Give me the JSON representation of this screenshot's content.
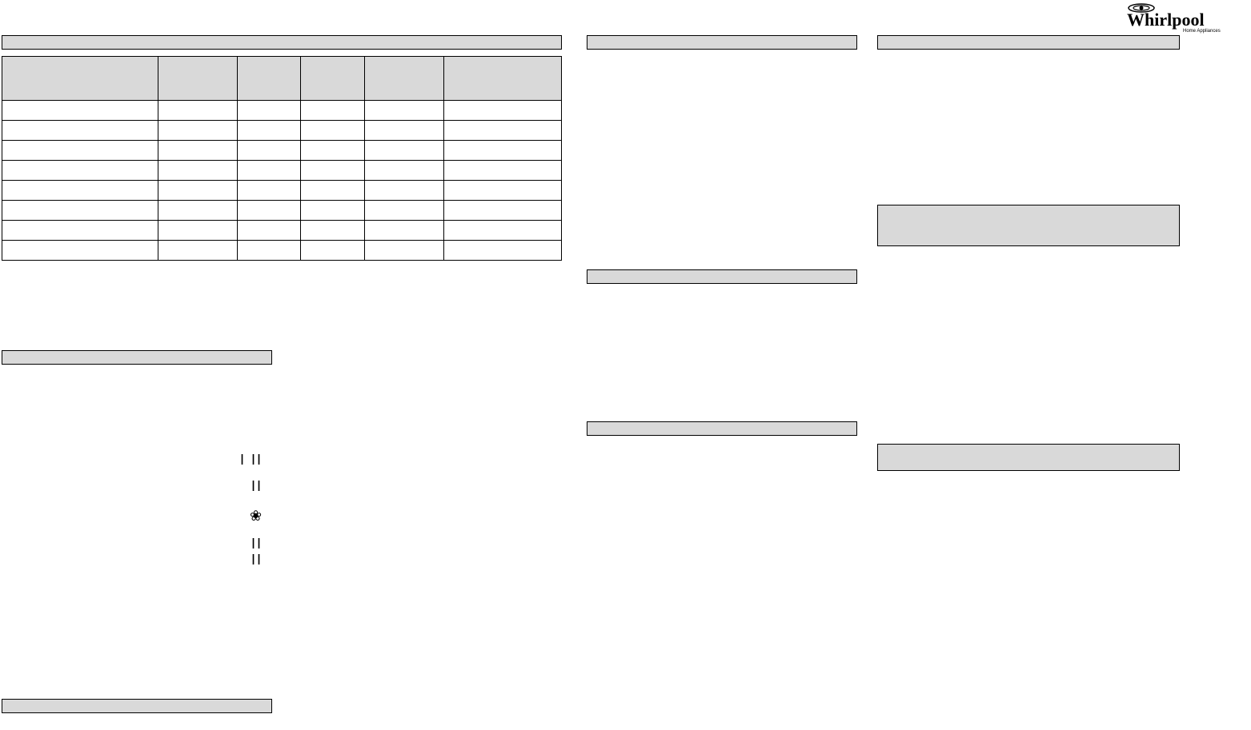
{
  "logo_text": "Whirlpool",
  "logo_sub": "Home Appliances",
  "table": {
    "headers": [
      "",
      "",
      "",
      "",
      "",
      ""
    ],
    "rows": [
      [
        "",
        "",
        "",
        "",
        "",
        ""
      ],
      [
        "",
        "",
        "",
        "",
        "",
        ""
      ],
      [
        "",
        "",
        "",
        "",
        "",
        ""
      ],
      [
        "",
        "",
        "",
        "",
        "",
        ""
      ],
      [
        "",
        "",
        "",
        "",
        "",
        ""
      ],
      [
        "",
        "",
        "",
        "",
        "",
        ""
      ],
      [
        "",
        "",
        "",
        "",
        "",
        ""
      ],
      [
        "",
        "",
        "",
        "",
        "",
        ""
      ]
    ]
  },
  "glyphs": {
    "g1": "I  II",
    "g2": "II",
    "g3": "❀",
    "g4": "II",
    "g5": "II"
  }
}
